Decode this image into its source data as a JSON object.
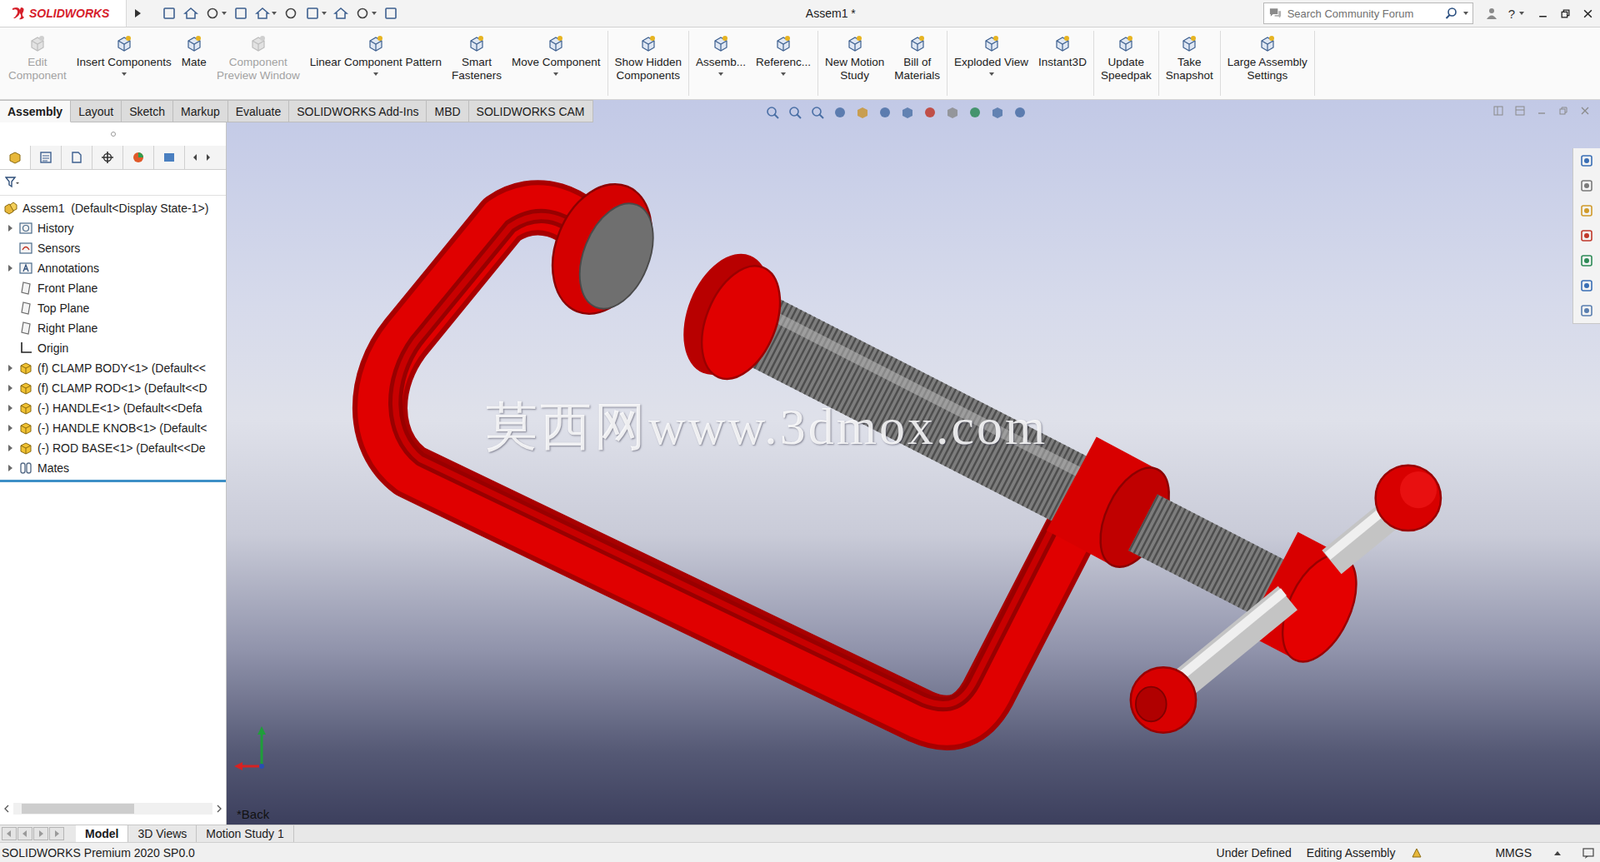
{
  "window": {
    "logo": "SOLIDWORKS",
    "title": "Assem1 *",
    "search": {
      "placeholder": "Search Community Forum"
    },
    "help": "?"
  },
  "ribbon": {
    "groups": [
      [
        {
          "label": "Edit\nComponent",
          "disabled": true,
          "dropdown": false
        },
        {
          "label": "Insert Components",
          "disabled": false,
          "dropdown": true
        },
        {
          "label": "Mate",
          "disabled": false,
          "dropdown": false
        },
        {
          "label": "Component\nPreview Window",
          "disabled": true,
          "dropdown": false
        },
        {
          "label": "Linear Component Pattern",
          "disabled": false,
          "dropdown": true
        },
        {
          "label": "Smart\nFasteners",
          "disabled": false,
          "dropdown": false
        },
        {
          "label": "Move Component",
          "disabled": false,
          "dropdown": true
        }
      ],
      [
        {
          "label": "Show Hidden\nComponents",
          "disabled": false,
          "dropdown": false
        }
      ],
      [
        {
          "label": "Assemb...",
          "disabled": false,
          "dropdown": true
        },
        {
          "label": "Referenc...",
          "disabled": false,
          "dropdown": true
        }
      ],
      [
        {
          "label": "New Motion\nStudy",
          "disabled": false,
          "dropdown": false
        },
        {
          "label": "Bill of\nMaterials",
          "disabled": false,
          "dropdown": false
        }
      ],
      [
        {
          "label": "Exploded View",
          "disabled": false,
          "dropdown": true
        },
        {
          "label": "Instant3D",
          "disabled": false,
          "dropdown": false
        }
      ],
      [
        {
          "label": "Update\nSpeedpak",
          "disabled": false,
          "dropdown": false
        }
      ],
      [
        {
          "label": "Take\nSnapshot",
          "disabled": false,
          "dropdown": false
        }
      ],
      [
        {
          "label": "Large Assembly\nSettings",
          "disabled": false,
          "dropdown": false
        }
      ]
    ]
  },
  "tabs": [
    {
      "label": "Assembly",
      "selected": true
    },
    {
      "label": "Layout",
      "selected": false
    },
    {
      "label": "Sketch",
      "selected": false
    },
    {
      "label": "Markup",
      "selected": false
    },
    {
      "label": "Evaluate",
      "selected": false
    },
    {
      "label": "SOLIDWORKS Add-Ins",
      "selected": false
    },
    {
      "label": "MBD",
      "selected": false
    },
    {
      "label": "SOLIDWORKS CAM",
      "selected": false
    }
  ],
  "tree": {
    "root": "Assem1  (Default<Display State-1>)",
    "items": [
      {
        "label": "History",
        "kind": "history",
        "expandable": true,
        "expanded": false
      },
      {
        "label": "Sensors",
        "kind": "sensors",
        "expandable": false,
        "expanded": false
      },
      {
        "label": "Annotations",
        "kind": "annotations",
        "expandable": true,
        "expanded": false
      },
      {
        "label": "Front Plane",
        "kind": "plane",
        "expandable": false,
        "expanded": false
      },
      {
        "label": "Top Plane",
        "kind": "plane",
        "expandable": false,
        "expanded": false
      },
      {
        "label": "Right Plane",
        "kind": "plane",
        "expandable": false,
        "expanded": false
      },
      {
        "label": "Origin",
        "kind": "origin",
        "expandable": false,
        "expanded": false
      },
      {
        "label": "(f) CLAMP BODY<1> (Default<<",
        "kind": "part",
        "expandable": true,
        "expanded": false
      },
      {
        "label": "(f) CLAMP ROD<1> (Default<<D",
        "kind": "part",
        "expandable": true,
        "expanded": false
      },
      {
        "label": "(-) HANDLE<1> (Default<<Defa",
        "kind": "part",
        "expandable": true,
        "expanded": false
      },
      {
        "label": "(-) HANDLE KNOB<1> (Default<",
        "kind": "part",
        "expandable": true,
        "expanded": false
      },
      {
        "label": "(-) ROD BASE<1> (Default<<De",
        "kind": "part",
        "expandable": true,
        "expanded": false
      },
      {
        "label": "Mates",
        "kind": "mates",
        "expandable": true,
        "expanded": false
      }
    ]
  },
  "viewport": {
    "view_label": "*Back",
    "watermark": "莫西网www.3dmox.com"
  },
  "bottom_tabs": [
    {
      "label": "Model",
      "selected": true
    },
    {
      "label": "3D Views",
      "selected": false
    },
    {
      "label": "Motion Study 1",
      "selected": false
    }
  ],
  "status_bar": {
    "product": "SOLIDWORKS Premium 2020 SP0.0",
    "state": "Under Defined",
    "mode": "Editing Assembly",
    "units": "MMGS"
  }
}
